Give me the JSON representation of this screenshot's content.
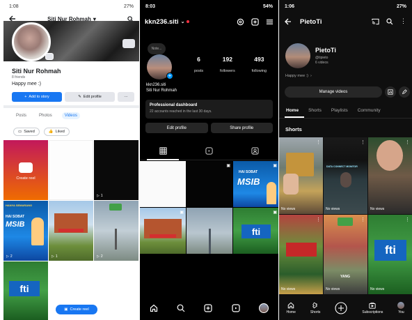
{
  "facebook": {
    "status": {
      "time": "1:08",
      "battery": "27%"
    },
    "header": {
      "title": "Siti Nur Rohmah"
    },
    "profile": {
      "name": "Siti Nur Rohmah",
      "friends": "8 friends",
      "bio": "Happy mee :)"
    },
    "buttons": {
      "add_story": "Add to story",
      "edit_profile": "Edit profile",
      "more": "···"
    },
    "tabs": [
      "Posts",
      "Photos",
      "Videos"
    ],
    "active_tab": "Videos",
    "chips": {
      "saved": "Saved",
      "liked": "Liked"
    },
    "grid": {
      "create_reel": "Create reel",
      "view_counts": [
        "1",
        "2",
        "1",
        "2"
      ]
    },
    "overlay_text": {
      "hai_sobat": "HAI SOBAT",
      "msib": "MSIB",
      "fti": "fti",
      "banner": "HANYA SEMARANG"
    },
    "fab": {
      "label": "Create reel"
    },
    "colors": {
      "accent": "#1877f2"
    }
  },
  "instagram": {
    "status": {
      "time": "8:03",
      "battery": "54%"
    },
    "header": {
      "username": "kkn236.siti"
    },
    "note": "Note...",
    "stats": [
      {
        "value": "6",
        "label": "posts"
      },
      {
        "value": "192",
        "label": "followers"
      },
      {
        "value": "493",
        "label": "following"
      }
    ],
    "profile": {
      "display": "kkn236.siti",
      "name": "Siti Nur Rohmah"
    },
    "dashboard": {
      "title": "Professional dashboard",
      "subtitle": "22 accounts reached in the last 30 days."
    },
    "buttons": {
      "edit_profile": "Edit profile",
      "share_profile": "Share profile"
    },
    "overlay_text": {
      "hai_sobat": "HAI SOBAT",
      "msib": "MSIB",
      "fti": "fti"
    },
    "colors": {
      "accent": "#0095f6",
      "live_dot": "#ff3040"
    }
  },
  "youtube": {
    "status": {
      "time": "1:06",
      "battery": "27%"
    },
    "header": {
      "title": "PietoTi"
    },
    "channel": {
      "name": "PietoTi",
      "handle": "@tipieto",
      "videos": "6 videos",
      "bio": "Happy mee :)"
    },
    "buttons": {
      "manage_videos": "Manage videos"
    },
    "tabs": [
      "Home",
      "Shorts",
      "Playlists",
      "Community"
    ],
    "active_tab": "Home",
    "section": "Shorts",
    "shorts": [
      {
        "views": "No views"
      },
      {
        "views": "No views"
      },
      {
        "views": "No views"
      },
      {
        "views": "No views"
      },
      {
        "views": "No views"
      },
      {
        "views": "No views"
      }
    ],
    "overlay_text": {
      "yang": "YANG",
      "fti": "fti",
      "data": "DATA CONNECT MONITOR"
    },
    "nav": [
      "Home",
      "Shorts",
      "",
      "Subscriptions",
      "You"
    ]
  }
}
